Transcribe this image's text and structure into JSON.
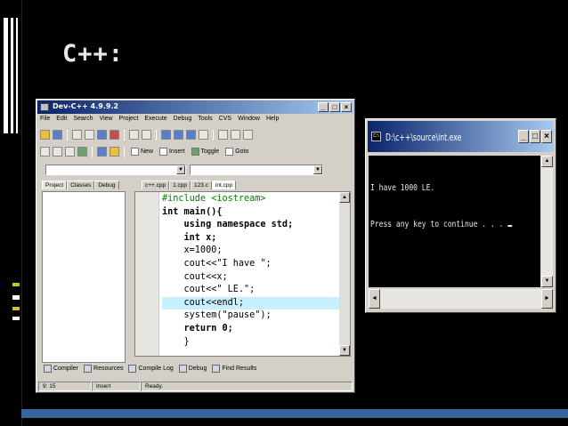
{
  "slide": {
    "title": "C++:"
  },
  "devcpp": {
    "title": "Dev-C++ 4.9.9.2",
    "menu": [
      "File",
      "Edit",
      "Search",
      "View",
      "Project",
      "Execute",
      "Debug",
      "Tools",
      "CVS",
      "Window",
      "Help"
    ],
    "toolbar_labels": {
      "new": "New",
      "insert": "Insert",
      "toggle": "Toggle",
      "goto": "Goto"
    },
    "left_tabs": [
      "Project",
      "Classes",
      "Debug"
    ],
    "editor_tabs": [
      "c++.cpp",
      "1.cpp",
      "123.c",
      "int.cpp"
    ],
    "code_lines": [
      "#include <iostream>",
      "int main(){",
      "    using namespace std;",
      "    int x;",
      "    x=1000;",
      "    cout<<\"I have \";",
      "    cout<<x;",
      "    cout<<\" LE.\";",
      "    cout<<endl;",
      "    system(\"pause\");",
      "    return 0;",
      "    }"
    ],
    "bottom_tabs": [
      "Compiler",
      "Resources",
      "Compile Log",
      "Debug",
      "Find Results"
    ],
    "status": {
      "position": "9: 15",
      "mode": "Insert",
      "state": "Ready."
    }
  },
  "console": {
    "title": "D:\\c++\\source\\int.exe",
    "output": [
      "I have 1000 LE.",
      "Press any key to continue . . . "
    ]
  },
  "colors": {
    "titlebar_start": "#0a246a",
    "titlebar_end": "#a6caf0",
    "accent_line": "#35659a",
    "current_line": "#c8f0ff"
  }
}
